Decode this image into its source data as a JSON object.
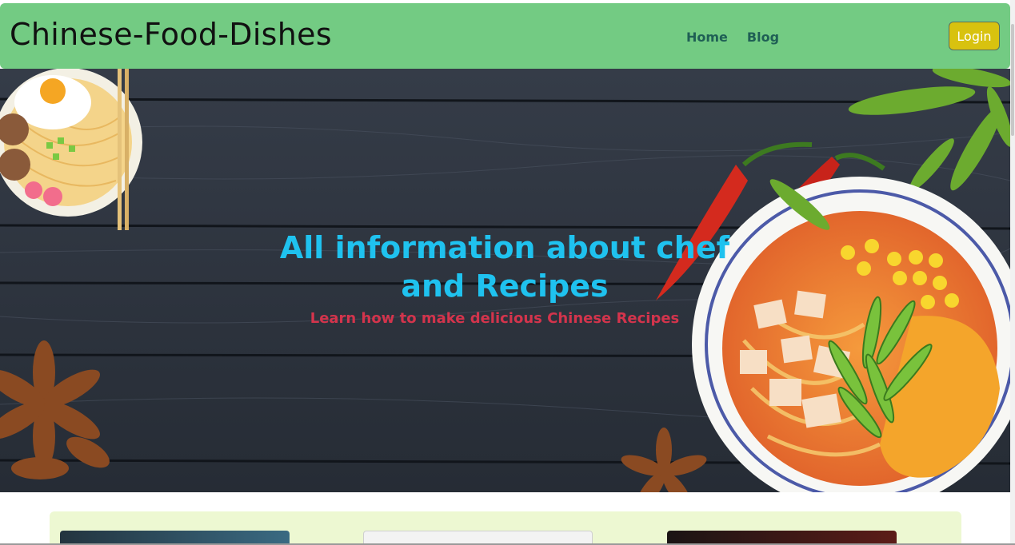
{
  "navbar": {
    "brand": "Chinese-Food-Dishes",
    "links": [
      "Home",
      "Blog"
    ],
    "login_label": "Login"
  },
  "hero": {
    "title": "All information about chef and Recipes",
    "subtitle": "Learn how to make delicious Chinese Recipes"
  },
  "colors": {
    "navbar_bg": "#73cb83",
    "login_bg": "#d8c20f",
    "hero_title": "#1fc2ef",
    "hero_subtitle": "#d3344c",
    "cards_bg": "#edf8d2"
  }
}
